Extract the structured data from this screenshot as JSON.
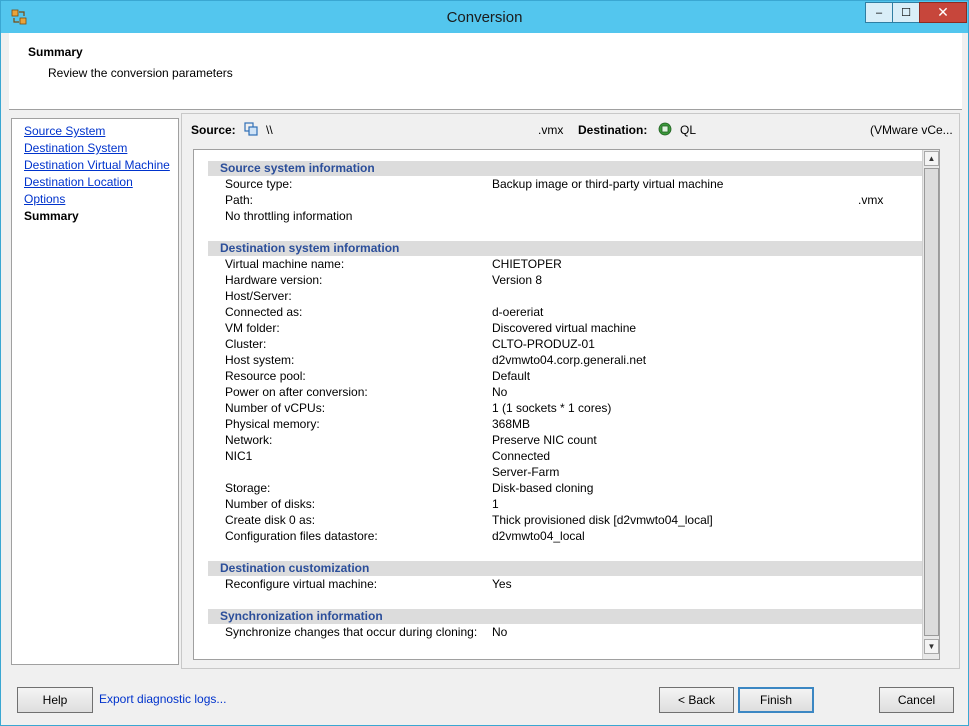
{
  "window": {
    "title": "Conversion"
  },
  "titlebar_buttons": {
    "minimize": "‒",
    "maximize": "☐",
    "close": "✕"
  },
  "header": {
    "title": "Summary",
    "subtitle": "Review the conversion parameters"
  },
  "nav": {
    "items": [
      {
        "label": "Source System"
      },
      {
        "label": "Destination System"
      },
      {
        "label": "Destination Virtual Machine"
      },
      {
        "label": "Destination Location"
      },
      {
        "label": "Options"
      },
      {
        "label": "Summary"
      }
    ]
  },
  "source_bar": {
    "source_label": "Source:",
    "source_value": "\\\\",
    "source_ext": ".vmx",
    "destination_label": "Destination:",
    "destination_value": "QL",
    "destination_suffix": "(VMware vCe..."
  },
  "sections": {
    "source_info": {
      "title": "Source system information",
      "rows": [
        {
          "label": "Source type:",
          "value": "Backup image or third-party virtual machine"
        },
        {
          "label": "Path:",
          "value": "",
          "value2": ".vmx"
        },
        {
          "label": "No throttling information",
          "value": ""
        }
      ]
    },
    "destination_info": {
      "title": "Destination system information",
      "rows": [
        {
          "label": "Virtual machine name:",
          "value": "CHIETOPER"
        },
        {
          "label": "Hardware version:",
          "value": "Version 8"
        },
        {
          "label": "Host/Server:",
          "value": ""
        },
        {
          "label": "Connected as:",
          "value": "d-oereriat"
        },
        {
          "label": "VM folder:",
          "value": "Discovered virtual machine"
        },
        {
          "label": "Cluster:",
          "value": "CLTO-PRODUZ-01"
        },
        {
          "label": "Host system:",
          "value": "d2vmwto04.corp.generali.net"
        },
        {
          "label": "Resource pool:",
          "value": "Default"
        },
        {
          "label": "Power on after conversion:",
          "value": "No"
        },
        {
          "label": "Number of vCPUs:",
          "value": "1 (1 sockets * 1 cores)"
        },
        {
          "label": "Physical memory:",
          "value": "368MB"
        },
        {
          "label": "Network:",
          "value": "Preserve NIC count"
        },
        {
          "label": "NIC1",
          "value": "Connected"
        },
        {
          "label": "",
          "value": "Server-Farm"
        },
        {
          "label": "Storage:",
          "value": "Disk-based cloning"
        },
        {
          "label": "Number of disks:",
          "value": "1"
        },
        {
          "label": "Create disk 0 as:",
          "value": "Thick provisioned disk [d2vmwto04_local]"
        },
        {
          "label": "Configuration files datastore:",
          "value": "d2vmwto04_local"
        }
      ]
    },
    "customization": {
      "title": "Destination customization",
      "rows": [
        {
          "label": "Reconfigure virtual machine:",
          "value": "Yes"
        }
      ]
    },
    "sync": {
      "title": "Synchronization information",
      "rows": [
        {
          "label": "Synchronize changes that occur during cloning:",
          "value": "No"
        }
      ]
    }
  },
  "footer": {
    "help_label": "Help",
    "export_logs": "Export diagnostic logs...",
    "back_label": "< Back",
    "finish_label": "Finish",
    "cancel_label": "Cancel"
  },
  "icons": {
    "app": "converter-icon",
    "source": "source-machine-icon",
    "destination": "vcenter-icon"
  },
  "colors": {
    "titlebar": "#53c6ee",
    "section_header_text": "#2b4e9a",
    "link": "#0033cc"
  }
}
